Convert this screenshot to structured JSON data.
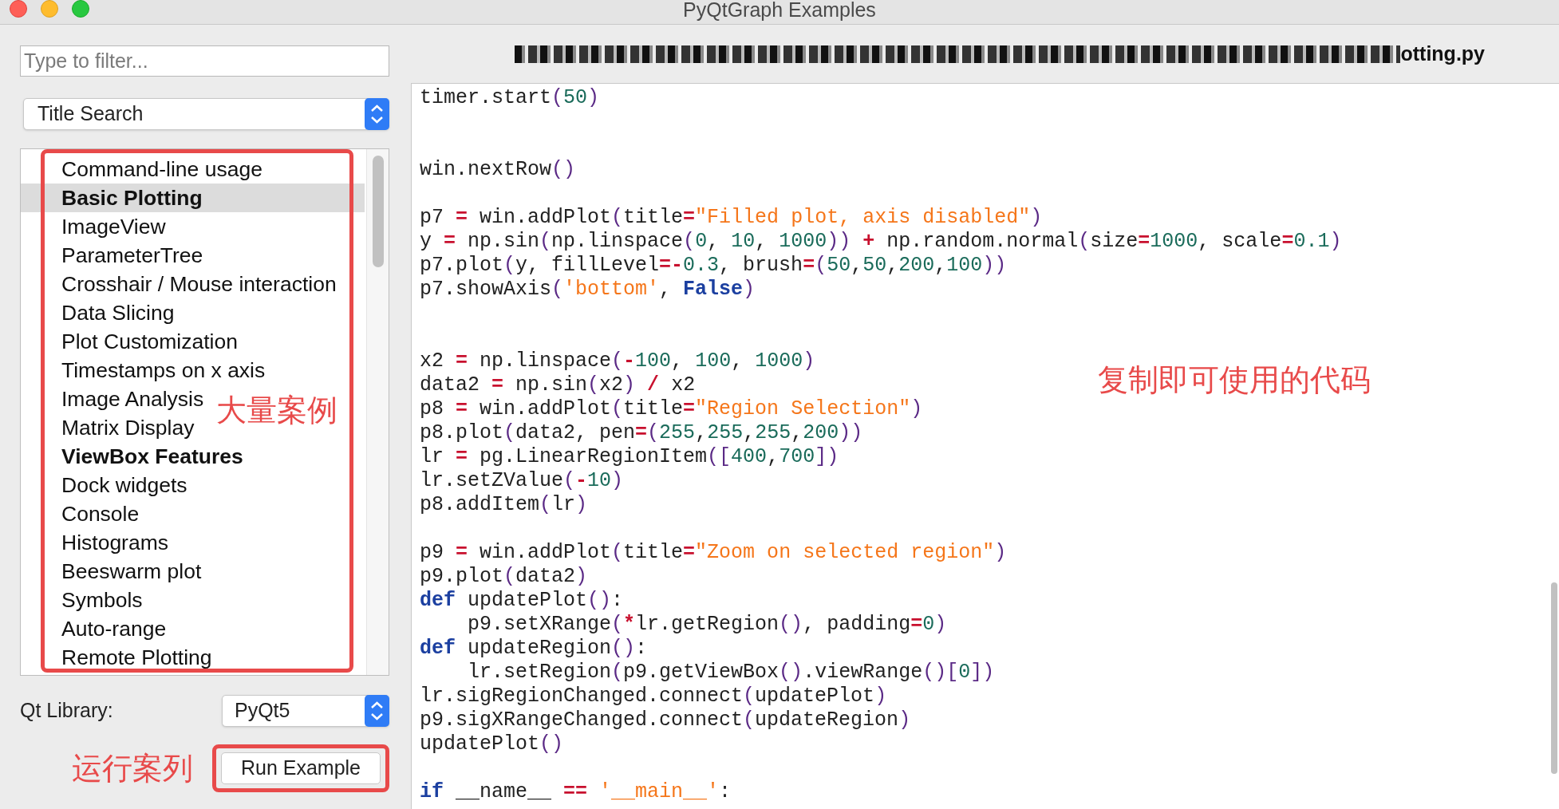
{
  "window": {
    "title": "PyQtGraph Examples"
  },
  "filter": {
    "placeholder": "Type to filter..."
  },
  "search_mode": {
    "value": "Title Search"
  },
  "examples": [
    {
      "label": "Command-line usage",
      "bold": false,
      "selected": false
    },
    {
      "label": "Basic Plotting",
      "bold": true,
      "selected": true
    },
    {
      "label": "ImageView",
      "bold": false,
      "selected": false
    },
    {
      "label": "ParameterTree",
      "bold": false,
      "selected": false
    },
    {
      "label": "Crosshair / Mouse interaction",
      "bold": false,
      "selected": false
    },
    {
      "label": "Data Slicing",
      "bold": false,
      "selected": false
    },
    {
      "label": "Plot Customization",
      "bold": false,
      "selected": false
    },
    {
      "label": "Timestamps on x axis",
      "bold": false,
      "selected": false
    },
    {
      "label": "Image Analysis",
      "bold": false,
      "selected": false
    },
    {
      "label": "Matrix Display",
      "bold": false,
      "selected": false
    },
    {
      "label": "ViewBox Features",
      "bold": true,
      "selected": false
    },
    {
      "label": "Dock widgets",
      "bold": false,
      "selected": false
    },
    {
      "label": "Console",
      "bold": false,
      "selected": false
    },
    {
      "label": "Histograms",
      "bold": false,
      "selected": false
    },
    {
      "label": "Beeswarm plot",
      "bold": false,
      "selected": false
    },
    {
      "label": "Symbols",
      "bold": false,
      "selected": false
    },
    {
      "label": "Auto-range",
      "bold": false,
      "selected": false
    },
    {
      "label": "Remote Plotting",
      "bold": false,
      "selected": false
    }
  ],
  "qt_library": {
    "label": "Qt Library:",
    "value": "PyQt5"
  },
  "run_button": {
    "label": "Run Example"
  },
  "file_name": {
    "visible_text": "otting.py"
  },
  "code_lines": [
    {
      "kind": "code",
      "tokens": [
        {
          "kind": "plain",
          "text": "timer.start"
        },
        {
          "kind": "bracket",
          "text": "("
        },
        {
          "kind": "number",
          "text": "50"
        },
        {
          "kind": "bracket",
          "text": ")"
        }
      ]
    },
    {
      "kind": "blank"
    },
    {
      "kind": "blank"
    },
    {
      "kind": "code",
      "tokens": [
        {
          "kind": "plain",
          "text": "win.nextRow"
        },
        {
          "kind": "bracket",
          "text": "()"
        }
      ]
    },
    {
      "kind": "blank"
    },
    {
      "kind": "code",
      "tokens": [
        {
          "kind": "plain",
          "text": "p7 "
        },
        {
          "kind": "operator",
          "text": "="
        },
        {
          "kind": "plain",
          "text": " win.addPlot"
        },
        {
          "kind": "bracket",
          "text": "("
        },
        {
          "kind": "plain",
          "text": "title"
        },
        {
          "kind": "operator",
          "text": "="
        },
        {
          "kind": "string",
          "text": "\"Filled plot, axis disabled\""
        },
        {
          "kind": "bracket",
          "text": ")"
        }
      ]
    },
    {
      "kind": "code",
      "tokens": [
        {
          "kind": "plain",
          "text": "y "
        },
        {
          "kind": "operator",
          "text": "="
        },
        {
          "kind": "plain",
          "text": " np.sin"
        },
        {
          "kind": "bracket",
          "text": "("
        },
        {
          "kind": "plain",
          "text": "np.linspace"
        },
        {
          "kind": "bracket",
          "text": "("
        },
        {
          "kind": "number",
          "text": "0"
        },
        {
          "kind": "plain",
          "text": ", "
        },
        {
          "kind": "number",
          "text": "10"
        },
        {
          "kind": "plain",
          "text": ", "
        },
        {
          "kind": "number",
          "text": "1000"
        },
        {
          "kind": "bracket",
          "text": "))"
        },
        {
          "kind": "operator",
          "text": " + "
        },
        {
          "kind": "plain",
          "text": "np.random.normal"
        },
        {
          "kind": "bracket",
          "text": "("
        },
        {
          "kind": "plain",
          "text": "size"
        },
        {
          "kind": "operator",
          "text": "="
        },
        {
          "kind": "number",
          "text": "1000"
        },
        {
          "kind": "plain",
          "text": ", scale"
        },
        {
          "kind": "operator",
          "text": "="
        },
        {
          "kind": "number",
          "text": "0.1"
        },
        {
          "kind": "bracket",
          "text": ")"
        }
      ]
    },
    {
      "kind": "code",
      "tokens": [
        {
          "kind": "plain",
          "text": "p7.plot"
        },
        {
          "kind": "bracket",
          "text": "("
        },
        {
          "kind": "plain",
          "text": "y, fillLevel"
        },
        {
          "kind": "operator",
          "text": "=-"
        },
        {
          "kind": "number",
          "text": "0.3"
        },
        {
          "kind": "plain",
          "text": ", brush"
        },
        {
          "kind": "operator",
          "text": "="
        },
        {
          "kind": "bracket",
          "text": "("
        },
        {
          "kind": "number",
          "text": "50"
        },
        {
          "kind": "plain",
          "text": ","
        },
        {
          "kind": "number",
          "text": "50"
        },
        {
          "kind": "plain",
          "text": ","
        },
        {
          "kind": "number",
          "text": "200"
        },
        {
          "kind": "plain",
          "text": ","
        },
        {
          "kind": "number",
          "text": "100"
        },
        {
          "kind": "bracket",
          "text": "))"
        }
      ]
    },
    {
      "kind": "code",
      "tokens": [
        {
          "kind": "plain",
          "text": "p7.showAxis"
        },
        {
          "kind": "bracket",
          "text": "("
        },
        {
          "kind": "string",
          "text": "'bottom'"
        },
        {
          "kind": "plain",
          "text": ", "
        },
        {
          "kind": "keyword",
          "text": "False"
        },
        {
          "kind": "bracket",
          "text": ")"
        }
      ]
    },
    {
      "kind": "blank"
    },
    {
      "kind": "blank"
    },
    {
      "kind": "code",
      "tokens": [
        {
          "kind": "plain",
          "text": "x2 "
        },
        {
          "kind": "operator",
          "text": "="
        },
        {
          "kind": "plain",
          "text": " np.linspace"
        },
        {
          "kind": "bracket",
          "text": "("
        },
        {
          "kind": "operator",
          "text": "-"
        },
        {
          "kind": "number",
          "text": "100"
        },
        {
          "kind": "plain",
          "text": ", "
        },
        {
          "kind": "number",
          "text": "100"
        },
        {
          "kind": "plain",
          "text": ", "
        },
        {
          "kind": "number",
          "text": "1000"
        },
        {
          "kind": "bracket",
          "text": ")"
        }
      ]
    },
    {
      "kind": "code",
      "tokens": [
        {
          "kind": "plain",
          "text": "data2 "
        },
        {
          "kind": "operator",
          "text": "="
        },
        {
          "kind": "plain",
          "text": " np.sin"
        },
        {
          "kind": "bracket",
          "text": "("
        },
        {
          "kind": "plain",
          "text": "x2"
        },
        {
          "kind": "bracket",
          "text": ")"
        },
        {
          "kind": "operator",
          "text": " / "
        },
        {
          "kind": "plain",
          "text": "x2"
        }
      ]
    },
    {
      "kind": "code",
      "tokens": [
        {
          "kind": "plain",
          "text": "p8 "
        },
        {
          "kind": "operator",
          "text": "="
        },
        {
          "kind": "plain",
          "text": " win.addPlot"
        },
        {
          "kind": "bracket",
          "text": "("
        },
        {
          "kind": "plain",
          "text": "title"
        },
        {
          "kind": "operator",
          "text": "="
        },
        {
          "kind": "string",
          "text": "\"Region Selection\""
        },
        {
          "kind": "bracket",
          "text": ")"
        }
      ]
    },
    {
      "kind": "code",
      "tokens": [
        {
          "kind": "plain",
          "text": "p8.plot"
        },
        {
          "kind": "bracket",
          "text": "("
        },
        {
          "kind": "plain",
          "text": "data2, pen"
        },
        {
          "kind": "operator",
          "text": "="
        },
        {
          "kind": "bracket",
          "text": "("
        },
        {
          "kind": "number",
          "text": "255"
        },
        {
          "kind": "plain",
          "text": ","
        },
        {
          "kind": "number",
          "text": "255"
        },
        {
          "kind": "plain",
          "text": ","
        },
        {
          "kind": "number",
          "text": "255"
        },
        {
          "kind": "plain",
          "text": ","
        },
        {
          "kind": "number",
          "text": "200"
        },
        {
          "kind": "bracket",
          "text": "))"
        }
      ]
    },
    {
      "kind": "code",
      "tokens": [
        {
          "kind": "plain",
          "text": "lr "
        },
        {
          "kind": "operator",
          "text": "="
        },
        {
          "kind": "plain",
          "text": " pg.LinearRegionItem"
        },
        {
          "kind": "bracket",
          "text": "(["
        },
        {
          "kind": "number",
          "text": "400"
        },
        {
          "kind": "plain",
          "text": ","
        },
        {
          "kind": "number",
          "text": "700"
        },
        {
          "kind": "bracket",
          "text": "])"
        }
      ]
    },
    {
      "kind": "code",
      "tokens": [
        {
          "kind": "plain",
          "text": "lr.setZValue"
        },
        {
          "kind": "bracket",
          "text": "("
        },
        {
          "kind": "operator",
          "text": "-"
        },
        {
          "kind": "number",
          "text": "10"
        },
        {
          "kind": "bracket",
          "text": ")"
        }
      ]
    },
    {
      "kind": "code",
      "tokens": [
        {
          "kind": "plain",
          "text": "p8.addItem"
        },
        {
          "kind": "bracket",
          "text": "("
        },
        {
          "kind": "plain",
          "text": "lr"
        },
        {
          "kind": "bracket",
          "text": ")"
        }
      ]
    },
    {
      "kind": "blank"
    },
    {
      "kind": "code",
      "tokens": [
        {
          "kind": "plain",
          "text": "p9 "
        },
        {
          "kind": "operator",
          "text": "="
        },
        {
          "kind": "plain",
          "text": " win.addPlot"
        },
        {
          "kind": "bracket",
          "text": "("
        },
        {
          "kind": "plain",
          "text": "title"
        },
        {
          "kind": "operator",
          "text": "="
        },
        {
          "kind": "string",
          "text": "\"Zoom on selected region\""
        },
        {
          "kind": "bracket",
          "text": ")"
        }
      ]
    },
    {
      "kind": "code",
      "tokens": [
        {
          "kind": "plain",
          "text": "p9.plot"
        },
        {
          "kind": "bracket",
          "text": "("
        },
        {
          "kind": "plain",
          "text": "data2"
        },
        {
          "kind": "bracket",
          "text": ")"
        }
      ]
    },
    {
      "kind": "code",
      "tokens": [
        {
          "kind": "keyword",
          "text": "def"
        },
        {
          "kind": "plain",
          "text": " updatePlot"
        },
        {
          "kind": "bracket",
          "text": "()"
        },
        {
          "kind": "plain",
          "text": ":"
        }
      ]
    },
    {
      "kind": "code",
      "tokens": [
        {
          "kind": "plain",
          "text": "    p9.setXRange"
        },
        {
          "kind": "bracket",
          "text": "("
        },
        {
          "kind": "operator",
          "text": "*"
        },
        {
          "kind": "plain",
          "text": "lr.getRegion"
        },
        {
          "kind": "bracket",
          "text": "()"
        },
        {
          "kind": "plain",
          "text": ", padding"
        },
        {
          "kind": "operator",
          "text": "="
        },
        {
          "kind": "number",
          "text": "0"
        },
        {
          "kind": "bracket",
          "text": ")"
        }
      ]
    },
    {
      "kind": "code",
      "tokens": [
        {
          "kind": "keyword",
          "text": "def"
        },
        {
          "kind": "plain",
          "text": " updateRegion"
        },
        {
          "kind": "bracket",
          "text": "()"
        },
        {
          "kind": "plain",
          "text": ":"
        }
      ]
    },
    {
      "kind": "code",
      "tokens": [
        {
          "kind": "plain",
          "text": "    lr.setRegion"
        },
        {
          "kind": "bracket",
          "text": "("
        },
        {
          "kind": "plain",
          "text": "p9.getViewBox"
        },
        {
          "kind": "bracket",
          "text": "()"
        },
        {
          "kind": "plain",
          "text": ".viewRange"
        },
        {
          "kind": "bracket",
          "text": "()["
        },
        {
          "kind": "number",
          "text": "0"
        },
        {
          "kind": "bracket",
          "text": "])"
        }
      ]
    },
    {
      "kind": "code",
      "tokens": [
        {
          "kind": "plain",
          "text": "lr.sigRegionChanged.connect"
        },
        {
          "kind": "bracket",
          "text": "("
        },
        {
          "kind": "plain",
          "text": "updatePlot"
        },
        {
          "kind": "bracket",
          "text": ")"
        }
      ]
    },
    {
      "kind": "code",
      "tokens": [
        {
          "kind": "plain",
          "text": "p9.sigXRangeChanged.connect"
        },
        {
          "kind": "bracket",
          "text": "("
        },
        {
          "kind": "plain",
          "text": "updateRegion"
        },
        {
          "kind": "bracket",
          "text": ")"
        }
      ]
    },
    {
      "kind": "code",
      "tokens": [
        {
          "kind": "plain",
          "text": "updatePlot"
        },
        {
          "kind": "bracket",
          "text": "()"
        }
      ]
    },
    {
      "kind": "blank"
    },
    {
      "kind": "code",
      "tokens": [
        {
          "kind": "keyword",
          "text": "if"
        },
        {
          "kind": "plain",
          "text": " __name__"
        },
        {
          "kind": "operator",
          "text": " == "
        },
        {
          "kind": "string",
          "text": "'__main__'"
        },
        {
          "kind": "plain",
          "text": ":"
        }
      ]
    }
  ],
  "annotations": {
    "list_note": "大量案例",
    "run_note": "运行案列",
    "code_note": "复制即可使用的代码"
  }
}
